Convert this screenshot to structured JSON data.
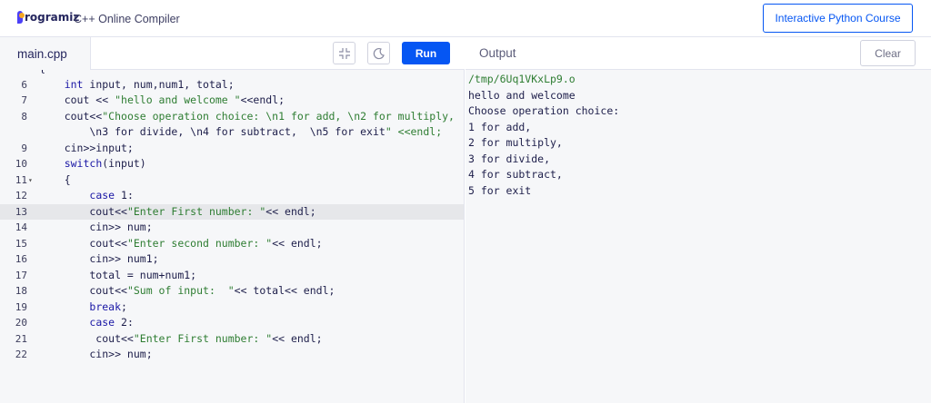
{
  "header": {
    "logo_text": "rogramiz",
    "app_title": "C++ Online Compiler",
    "course_button": "Interactive Python Course"
  },
  "editor": {
    "file_name": "main.cpp",
    "run_label": "Run",
    "lines": [
      {
        "num": "",
        "code": "{"
      },
      {
        "num": "6",
        "code": "    int input, num,num1, total;"
      },
      {
        "num": "7",
        "code": "    cout << \"hello and welcome \"<<endl;"
      },
      {
        "num": "8",
        "code": "    cout<<\"Choose operation choice: \\n1 for add, \\n2 for multiply,"
      },
      {
        "num": "",
        "code": "        \\n3 for divide, \\n4 for subtract,  \\n5 for exit\" <<endl;"
      },
      {
        "num": "9",
        "code": "    cin>>input;"
      },
      {
        "num": "10",
        "code": "    switch(input)"
      },
      {
        "num": "11",
        "code": "    {",
        "fold": true
      },
      {
        "num": "12",
        "code": "        case 1:"
      },
      {
        "num": "13",
        "code": "        cout<<\"Enter First number: \"<< endl;",
        "active": true
      },
      {
        "num": "14",
        "code": "        cin>> num;"
      },
      {
        "num": "15",
        "code": "        cout<<\"Enter second number: \"<< endl;"
      },
      {
        "num": "16",
        "code": "        cin>> num1;"
      },
      {
        "num": "17",
        "code": "        total = num+num1;"
      },
      {
        "num": "18",
        "code": "        cout<<\"Sum of input:  \"<< total<< endl;"
      },
      {
        "num": "19",
        "code": "        break;"
      },
      {
        "num": "20",
        "code": "        case 2:"
      },
      {
        "num": "21",
        "code": "         cout<<\"Enter First number: \"<< endl;"
      },
      {
        "num": "22",
        "code": "        cin>> num;"
      }
    ]
  },
  "output": {
    "title": "Output",
    "clear_label": "Clear",
    "lines": [
      "/tmp/6Uq1VKxLp9.o",
      "hello and welcome",
      "Choose operation choice:",
      "1 for add,",
      "2 for multiply,",
      "3 for divide,",
      "4 for subtract,",
      "5 for exit"
    ]
  },
  "colors": {
    "brand": "#0556f3",
    "keyword": "#1a17a5",
    "string": "#2e7d32"
  },
  "icons": [
    "collapse-icon",
    "moon-icon",
    "fold-arrow-icon"
  ]
}
